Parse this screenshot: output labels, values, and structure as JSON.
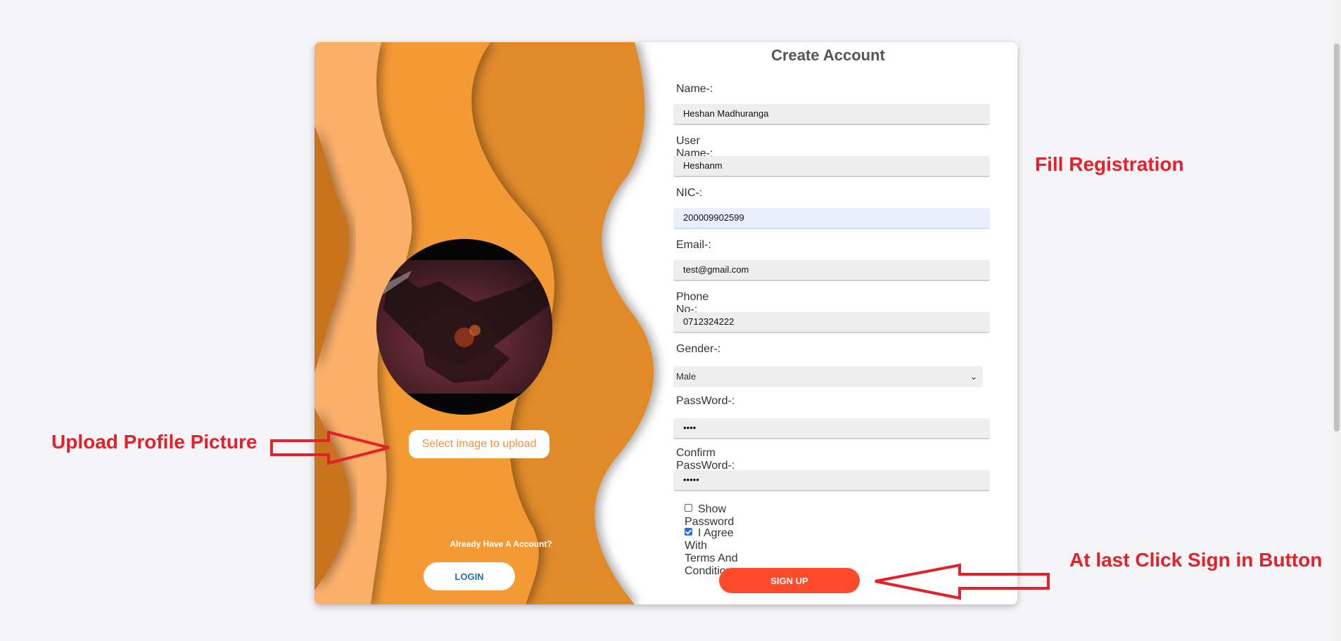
{
  "left_panel": {
    "upload_button": "Select image to upload",
    "already_text": "Already Have A Account?",
    "login_button": "LOGIN"
  },
  "form": {
    "title": "Create Account",
    "fields": [
      {
        "label": "Name-:",
        "value": "Heshan Madhuranga"
      },
      {
        "label": "User Name-:",
        "value": "Heshanm"
      },
      {
        "label": "NIC-:",
        "value": "200009902599"
      },
      {
        "label": "Email-:",
        "value": "test@gmail.com"
      },
      {
        "label": "Phone No-:",
        "value": "0712324222"
      }
    ],
    "gender": {
      "label": "Gender-:",
      "selected": "Male"
    },
    "password": {
      "label": "PassWord-:",
      "value": "••••"
    },
    "confirm_password": {
      "label": "Confirm PassWord-:",
      "value": "•••••"
    },
    "show_password": {
      "label": "Show Password",
      "checked": false
    },
    "agree_terms": {
      "label": "I Agree With Terms And Conditions",
      "checked": true
    },
    "signup_button": "SIGN UP"
  },
  "annotations": {
    "fill_registration": "Fill Registration",
    "upload_profile": "Upload Profile Picture",
    "click_sign": "At last Click Sign in Button"
  },
  "colors": {
    "accent": "#ff4b2b",
    "orange_light": "#fbb06a",
    "orange_mid": "#f39530",
    "orange_dark": "#d27618",
    "annotation_red": "#e3212a"
  }
}
